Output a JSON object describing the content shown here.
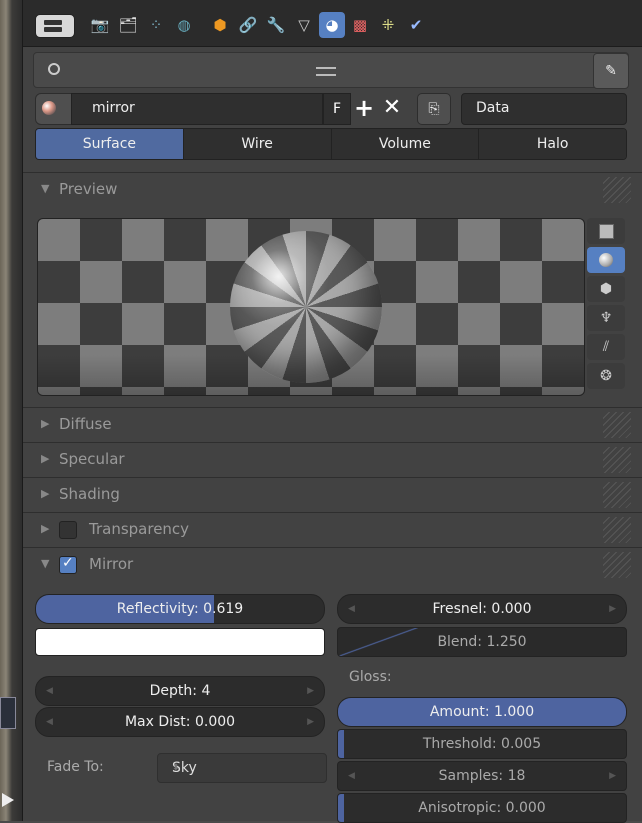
{
  "material": {
    "name": "mirror",
    "f_label": "F",
    "add_label": "+",
    "remove_label": "✕",
    "data_mode": "Data"
  },
  "type_tabs": [
    {
      "label": "Surface",
      "active": true
    },
    {
      "label": "Wire",
      "active": false
    },
    {
      "label": "Volume",
      "active": false
    },
    {
      "label": "Halo",
      "active": false
    }
  ],
  "panels": {
    "preview": "Preview",
    "diffuse": "Diffuse",
    "specular": "Specular",
    "shading": "Shading",
    "transparency": "Transparency",
    "mirror": "Mirror"
  },
  "transparency_enabled": false,
  "mirror_enabled": true,
  "mirror": {
    "reflectivity": "Reflectivity: 0.619",
    "reflectivity_value": 0.619,
    "fresnel": "Fresnel: 0.000",
    "blend": "Blend: 1.250",
    "mirror_color": "#ffffff",
    "depth": "Depth: 4",
    "max_dist": "Max Dist: 0.000",
    "gloss_label": "Gloss:",
    "amount": "Amount: 1.000",
    "amount_value": 1.0,
    "threshold": "Threshold: 0.005",
    "samples": "Samples: 18",
    "anisotropic": "Anisotropic: 0.000",
    "fade_to_label": "Fade To:",
    "fade_to_value": "Sky"
  },
  "colors": {
    "accent": "#5680c2",
    "panel_bg": "#424242",
    "field_bg": "#2c2c2c"
  },
  "icons": {
    "property_tabs": [
      "render-icon",
      "render-layers-icon",
      "scene-icon",
      "world-icon",
      "object-icon",
      "constraints-icon",
      "modifiers-icon",
      "data-icon",
      "material-icon",
      "texture-icon",
      "particles-icon",
      "physics-icon"
    ],
    "preview_types": [
      "plane-icon",
      "sphere-icon",
      "cube-icon",
      "monkey-icon",
      "hair-icon",
      "sphere-sky-icon"
    ]
  }
}
